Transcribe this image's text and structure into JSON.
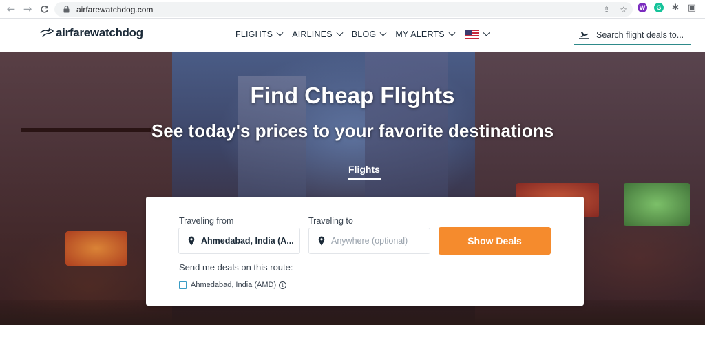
{
  "browser": {
    "url": "airfarewatchdog.com",
    "back_glyph": "←",
    "forward_glyph": "→",
    "reload_glyph": "C",
    "share_glyph": "⇪",
    "star_glyph": "☆",
    "ext_purple_glyph": "W",
    "ext_green_glyph": "G",
    "puzzle_glyph": "✱",
    "panel_glyph": "▣"
  },
  "header": {
    "logo_text": "airfarewatchdog",
    "nav": [
      {
        "label": "FLIGHTS"
      },
      {
        "label": "AIRLINES"
      },
      {
        "label": "BLOG"
      },
      {
        "label": "MY ALERTS"
      }
    ],
    "search_placeholder": "Search flight deals to..."
  },
  "hero": {
    "title": "Find Cheap Flights",
    "subtitle": "See today's prices to your favorite destinations",
    "active_tab": "Flights"
  },
  "form": {
    "from_label": "Traveling from",
    "from_value": "Ahmedabad, India (A...",
    "to_label": "Traveling to",
    "to_placeholder": "Anywhere (optional)",
    "submit_label": "Show Deals",
    "deals_label": "Send me deals on this route:",
    "route_checkbox_label": "Ahmedabad, India (AMD)",
    "route_checked": false
  },
  "colors": {
    "accent_orange": "#f58b2d",
    "teal_underline": "#2e8a8a",
    "text_dark": "#1b2a38",
    "checkbox_border": "#3a9cc4"
  },
  "icons": {
    "lock": "lock-icon",
    "plane": "plane-icon",
    "pin": "location-pin-icon",
    "info": "info-icon",
    "flag": "us-flag-icon"
  }
}
